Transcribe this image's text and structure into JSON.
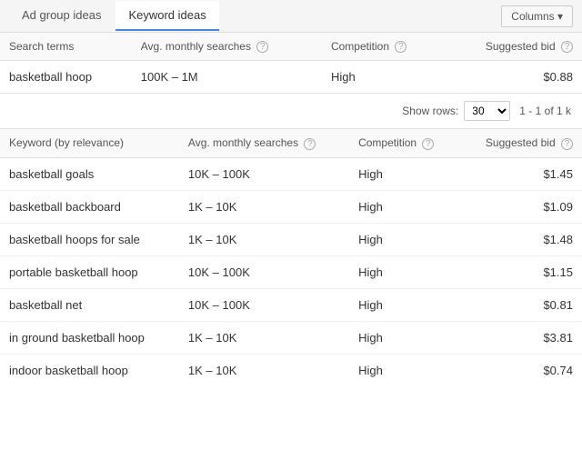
{
  "tabs": [
    {
      "label": "Ad group ideas",
      "active": false
    },
    {
      "label": "Keyword ideas",
      "active": true
    }
  ],
  "toolbar": {
    "columns_label": "Columns ▾"
  },
  "search_terms_table": {
    "headers": [
      {
        "label": "Search terms",
        "align": "left",
        "help": true
      },
      {
        "label": "Avg. monthly searches",
        "align": "left",
        "help": true
      },
      {
        "label": "Competition",
        "align": "left",
        "help": true
      },
      {
        "label": "Suggested bid",
        "align": "right",
        "help": true
      }
    ],
    "rows": [
      {
        "term": "basketball hoop",
        "avg_searches": "100K – 1M",
        "competition": "High",
        "suggested_bid": "$0.88"
      }
    ]
  },
  "pagination": {
    "show_rows_label": "Show rows:",
    "rows_value": "30",
    "range": "1 - 1 of 1 k"
  },
  "keyword_ideas_table": {
    "headers": [
      {
        "label": "Keyword (by relevance)",
        "align": "left",
        "help": false
      },
      {
        "label": "Avg. monthly searches",
        "align": "left",
        "help": true
      },
      {
        "label": "Competition",
        "align": "left",
        "help": true
      },
      {
        "label": "Suggested bid",
        "align": "right",
        "help": true
      }
    ],
    "rows": [
      {
        "term": "basketball goals",
        "avg_searches": "10K – 100K",
        "competition": "High",
        "suggested_bid": "$1.45"
      },
      {
        "term": "basketball backboard",
        "avg_searches": "1K – 10K",
        "competition": "High",
        "suggested_bid": "$1.09"
      },
      {
        "term": "basketball hoops for sale",
        "avg_searches": "1K – 10K",
        "competition": "High",
        "suggested_bid": "$1.48"
      },
      {
        "term": "portable basketball hoop",
        "avg_searches": "10K – 100K",
        "competition": "High",
        "suggested_bid": "$1.15"
      },
      {
        "term": "basketball net",
        "avg_searches": "10K – 100K",
        "competition": "High",
        "suggested_bid": "$0.81"
      },
      {
        "term": "in ground basketball hoop",
        "avg_searches": "1K – 10K",
        "competition": "High",
        "suggested_bid": "$3.81"
      },
      {
        "term": "indoor basketball hoop",
        "avg_searches": "1K – 10K",
        "competition": "High",
        "suggested_bid": "$0.74"
      }
    ]
  }
}
